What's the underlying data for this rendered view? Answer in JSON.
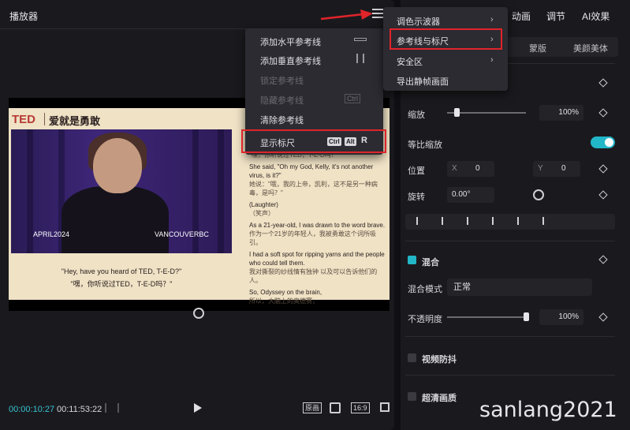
{
  "player": {
    "title": "播放器",
    "current_time": "00:00:10:27",
    "total_time": "00:11:53:22",
    "original_label": "原画",
    "ratio_label": "16:9"
  },
  "video": {
    "logo": "TED",
    "title": "爱就是勇敢",
    "stage_left": "APRIL2024",
    "stage_right": "VANCOUVERBC",
    "caption_en": "\"Hey, have you heard of TED, T-E-D?\"",
    "caption_zh": "\"嘿，你听说过TED，T-E-D吗？\"",
    "transcript": [
      {
        "en": "",
        "zh": "\"嘿，你听说过TED，T-E-D吗？\""
      },
      {
        "en": "She said, \"Oh my God, Kelly, it's not another virus, is it?\"",
        "zh": "她说：\"哦，我的上帝，凯利，这不是另一种病毒，是吗？\""
      },
      {
        "en": "(Laughter)",
        "zh": "（笑声）"
      },
      {
        "en": "As a 21-year-old, I was drawn to the word brave.",
        "zh": "作为一个21岁的年轻人，我被勇敢这个词所吸引。"
      },
      {
        "en": "I had a soft spot for ripping yarns and the people who could tell them.",
        "zh": "我对撕裂的纱线情有独钟 以及可以告诉他们的人。"
      },
      {
        "en": "So, Odyssey on the brain,",
        "zh": "所以，大脑上的奥德赛，"
      }
    ]
  },
  "context_menu": {
    "add_horizontal": "添加水平参考线",
    "add_vertical": "添加垂直参考线",
    "lock": "锁定参考线",
    "hidden": "隐藏参考线",
    "hidden_kbd": "Ctrl",
    "clear": "清除参考线",
    "show_ruler": "显示标尺",
    "kbd_ctrl": "Ctrl",
    "kbd_alt": "Alt",
    "kbd_r": "R"
  },
  "submenu": {
    "scope": "调色示波器",
    "guides": "参考线与标尺",
    "safe_area": "安全区",
    "export_frame": "导出静帧画面"
  },
  "tabs": {
    "animation": "动画",
    "adjust": "调节",
    "ai": "AI效果"
  },
  "subtabs": {
    "mask": "蒙版",
    "beauty": "美颜美体"
  },
  "properties": {
    "scale_label": "缩放",
    "scale_value": "100%",
    "scale_level": 0.12,
    "uniform_label": "等比缩放",
    "position_label": "位置",
    "x_axis": "X",
    "x_value": "0",
    "y_axis": "Y",
    "y_value": "0",
    "rotation_label": "旋转",
    "rotation_value": "0.00°",
    "blend_label": "混合",
    "mode_label": "混合模式",
    "mode_value": "正常",
    "opacity_label": "不透明度",
    "opacity_value": "100%",
    "opacity_level": 1.0,
    "stabilize_label": "视频防抖",
    "hd_label": "超清画质"
  },
  "watermark": "sanlang2021",
  "colors": {
    "accent": "#22b7c8",
    "highlight": "#e0242a"
  }
}
